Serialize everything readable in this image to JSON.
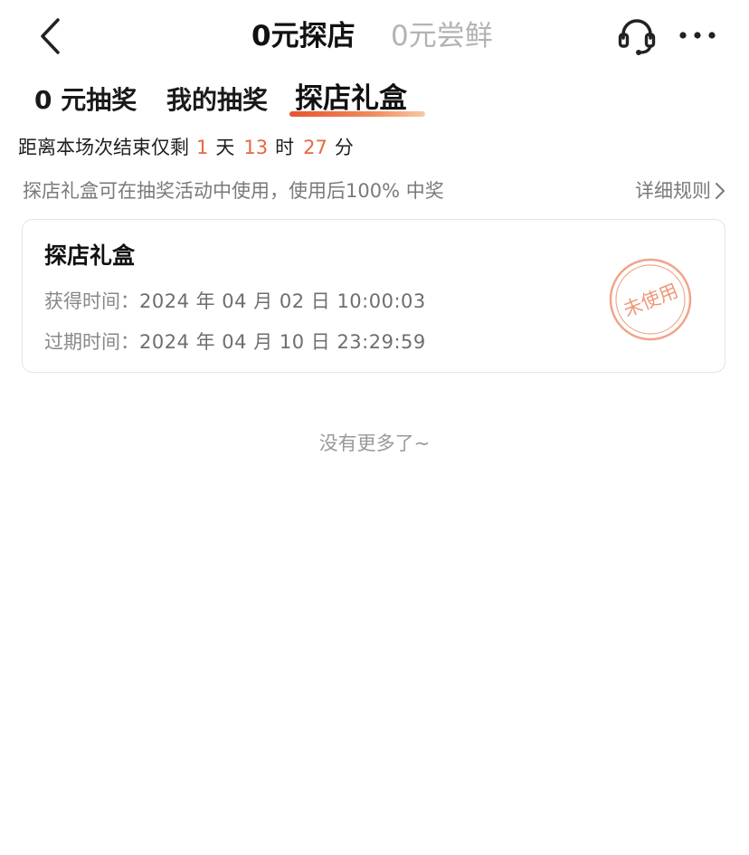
{
  "nav": {
    "back_icon": "chevron-left-icon",
    "tabs": [
      {
        "label": "0元探店",
        "active": true
      },
      {
        "label": "0元尝鲜",
        "active": false
      }
    ],
    "service_icon": "headset-icon",
    "more_icon": "more-dots-icon"
  },
  "subtabs": [
    {
      "label": "0 元抽奖",
      "active": false
    },
    {
      "label": "我的抽奖",
      "active": false
    },
    {
      "label": "探店礼盒",
      "active": true
    }
  ],
  "countdown": {
    "prefix": "距离本场次结束仅剩",
    "days": "1",
    "days_unit": "天",
    "hours": "13",
    "hours_unit": "时",
    "minutes": "27",
    "minutes_unit": "分"
  },
  "info": {
    "text": "探店礼盒可在抽奖活动中使用，使用后100% 中奖",
    "rules_label": "详细规则"
  },
  "card": {
    "title": "探店礼盒",
    "obtained_label": "获得时间：",
    "obtained_value": "2024 年 04 月 02 日 10:00:03",
    "expire_label": "过期时间：",
    "expire_value": "2024 年 04 月 10 日 23:29:59",
    "status": "未使用"
  },
  "footer": {
    "no_more": "没有更多了~"
  },
  "colors": {
    "accent": "#e8683e",
    "stamp": "#f0a58a",
    "muted": "#999999"
  }
}
